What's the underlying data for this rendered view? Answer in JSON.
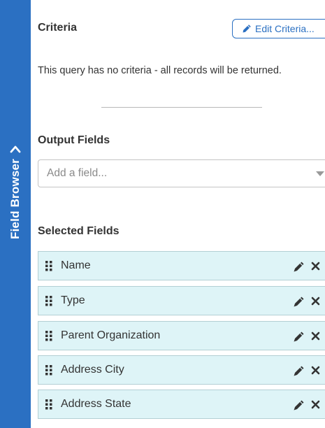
{
  "sidebar": {
    "label": "Field Browser"
  },
  "criteria": {
    "title": "Criteria",
    "edit_button": "Edit Criteria...",
    "message": "This query has no criteria - all records will be returned."
  },
  "output_fields": {
    "title": "Output Fields",
    "placeholder": "Add a field..."
  },
  "selected_fields": {
    "title": "Selected Fields",
    "items": [
      {
        "label": "Name"
      },
      {
        "label": "Type"
      },
      {
        "label": "Parent Organization"
      },
      {
        "label": "Address City"
      },
      {
        "label": "Address State"
      }
    ]
  },
  "colors": {
    "accent": "#2b70c2",
    "field_bg": "#def4f7",
    "field_border": "#b3cfd4"
  }
}
